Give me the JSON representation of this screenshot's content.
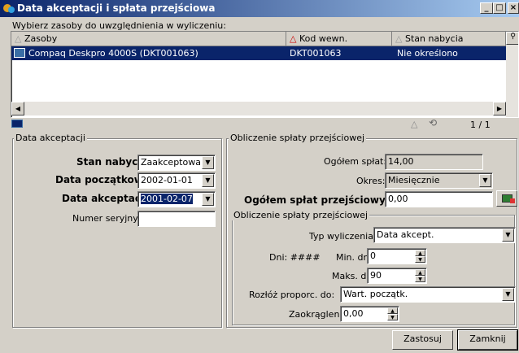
{
  "window": {
    "title": "Data akceptacji i spłata przejściowa",
    "controls": [
      "_",
      "□",
      "×"
    ]
  },
  "prompt": "Wybierz zasoby do uwzględnienia w wyliczeniu:",
  "table": {
    "columns": [
      "Zasoby",
      "Kod wewn.",
      "Stan nabycia"
    ],
    "rows": [
      {
        "asset": "Compaq Deskpro 4000S (DKT001063)",
        "code": "DKT001063",
        "status": "Nie określono"
      }
    ],
    "pager": "1 / 1"
  },
  "acceptance": {
    "title": "Data akceptacji",
    "status_label": "Stan nabycia:",
    "status_value": "Zaakceptowan",
    "start_label": "Data początkowa:",
    "start_value": "2002-01-01",
    "accept_label": "Data akceptacji:",
    "accept_value": "2001-02-07",
    "serial_label": "Numer seryjny:",
    "serial_value": ""
  },
  "calc": {
    "title": "Obliczenie spłaty przejściowej",
    "total_label": "Ogółem spłat:",
    "total_value": "14,00",
    "period_label": "Okres:",
    "period_value": "Miesięcznie",
    "interim_label": "Ogółem spłat przejściowych:",
    "interim_value": "0,00",
    "inner_title": "Obliczenie spłaty przejściowej",
    "type_label": "Typ wyliczenia:",
    "type_value": "Data akcept.",
    "days_label": "Dni: ####",
    "min_label": "Min. dni:",
    "min_value": "0",
    "max_label": "Maks. dni:",
    "max_value": "90",
    "distribute_label": "Rozłóż proporc. do:",
    "distribute_value": "Wart. początk.",
    "rounding_label": "Zaokrąglenie:",
    "rounding_value": "0,00"
  },
  "buttons": {
    "apply": "Zastosuj",
    "close": "Zamknij"
  },
  "colors": {
    "title_start": "#0a246a",
    "title_end": "#a6caf0",
    "selection": "#0a246a",
    "face": "#d4d0c8"
  }
}
